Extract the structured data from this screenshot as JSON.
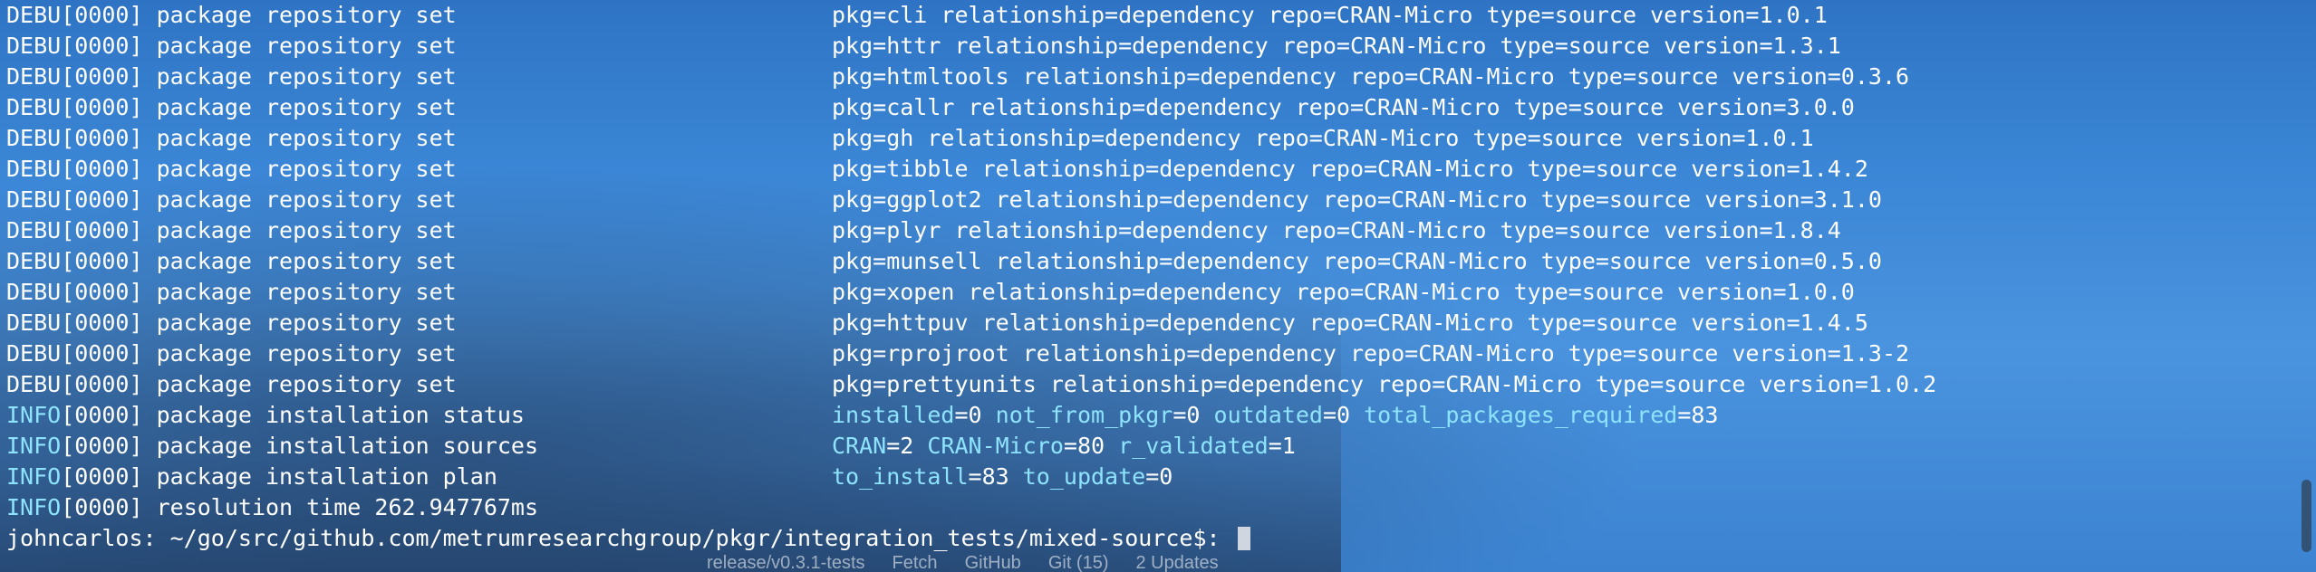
{
  "terminal": {
    "lines": [
      {
        "level": "DEBU",
        "tag": "DEBU[0000]",
        "msg": "package repository set",
        "detail": "pkg=cli relationship=dependency repo=CRAN-Micro type=source version=1.0.1"
      },
      {
        "level": "DEBU",
        "tag": "DEBU[0000]",
        "msg": "package repository set",
        "detail": "pkg=httr relationship=dependency repo=CRAN-Micro type=source version=1.3.1"
      },
      {
        "level": "DEBU",
        "tag": "DEBU[0000]",
        "msg": "package repository set",
        "detail": "pkg=htmltools relationship=dependency repo=CRAN-Micro type=source version=0.3.6"
      },
      {
        "level": "DEBU",
        "tag": "DEBU[0000]",
        "msg": "package repository set",
        "detail": "pkg=callr relationship=dependency repo=CRAN-Micro type=source version=3.0.0"
      },
      {
        "level": "DEBU",
        "tag": "DEBU[0000]",
        "msg": "package repository set",
        "detail": "pkg=gh relationship=dependency repo=CRAN-Micro type=source version=1.0.1"
      },
      {
        "level": "DEBU",
        "tag": "DEBU[0000]",
        "msg": "package repository set",
        "detail": "pkg=tibble relationship=dependency repo=CRAN-Micro type=source version=1.4.2"
      },
      {
        "level": "DEBU",
        "tag": "DEBU[0000]",
        "msg": "package repository set",
        "detail": "pkg=ggplot2 relationship=dependency repo=CRAN-Micro type=source version=3.1.0"
      },
      {
        "level": "DEBU",
        "tag": "DEBU[0000]",
        "msg": "package repository set",
        "detail": "pkg=plyr relationship=dependency repo=CRAN-Micro type=source version=1.8.4"
      },
      {
        "level": "DEBU",
        "tag": "DEBU[0000]",
        "msg": "package repository set",
        "detail": "pkg=munsell relationship=dependency repo=CRAN-Micro type=source version=0.5.0"
      },
      {
        "level": "DEBU",
        "tag": "DEBU[0000]",
        "msg": "package repository set",
        "detail": "pkg=xopen relationship=dependency repo=CRAN-Micro type=source version=1.0.0"
      },
      {
        "level": "DEBU",
        "tag": "DEBU[0000]",
        "msg": "package repository set",
        "detail": "pkg=httpuv relationship=dependency repo=CRAN-Micro type=source version=1.4.5"
      },
      {
        "level": "DEBU",
        "tag": "DEBU[0000]",
        "msg": "package repository set",
        "detail": "pkg=rprojroot relationship=dependency repo=CRAN-Micro type=source version=1.3-2"
      },
      {
        "level": "DEBU",
        "tag": "DEBU[0000]",
        "msg": "package repository set",
        "detail": "pkg=prettyunits relationship=dependency repo=CRAN-Micro type=source version=1.0.2"
      }
    ],
    "info_lines": [
      {
        "tag": "INFO",
        "tag_rest": "[0000]",
        "msg": "package installation status",
        "fields": [
          {
            "key": "installed",
            "value": "0"
          },
          {
            "key": "not_from_pkgr",
            "value": "0"
          },
          {
            "key": "outdated",
            "value": "0"
          },
          {
            "key": "total_packages_required",
            "value": "83"
          }
        ]
      },
      {
        "tag": "INFO",
        "tag_rest": "[0000]",
        "msg": "package installation sources",
        "fields": [
          {
            "key": "CRAN",
            "value": "2"
          },
          {
            "key": "CRAN-Micro",
            "value": "80"
          },
          {
            "key": "r_validated",
            "value": "1"
          }
        ]
      },
      {
        "tag": "INFO",
        "tag_rest": "[0000]",
        "msg": "package installation plan",
        "fields": [
          {
            "key": "to_install",
            "value": "83"
          },
          {
            "key": "to_update",
            "value": "0"
          }
        ]
      },
      {
        "tag": "INFO",
        "tag_rest": "[0000]",
        "msg": "resolution time 262.947767ms",
        "fields": []
      }
    ],
    "prompt": "johncarlos: ~/go/src/github.com/metrumresearchgroup/pkgr/integration_tests/mixed-source$: "
  },
  "background_dock": {
    "items": [
      "release/v0.3.1-tests",
      "Fetch",
      "GitHub",
      "Git (15)",
      "2 Updates"
    ]
  },
  "colors": {
    "info": "#8ee3ff",
    "debu": "#ffffff",
    "background": "#3a7fc9",
    "cursor": "#cfd6df"
  }
}
